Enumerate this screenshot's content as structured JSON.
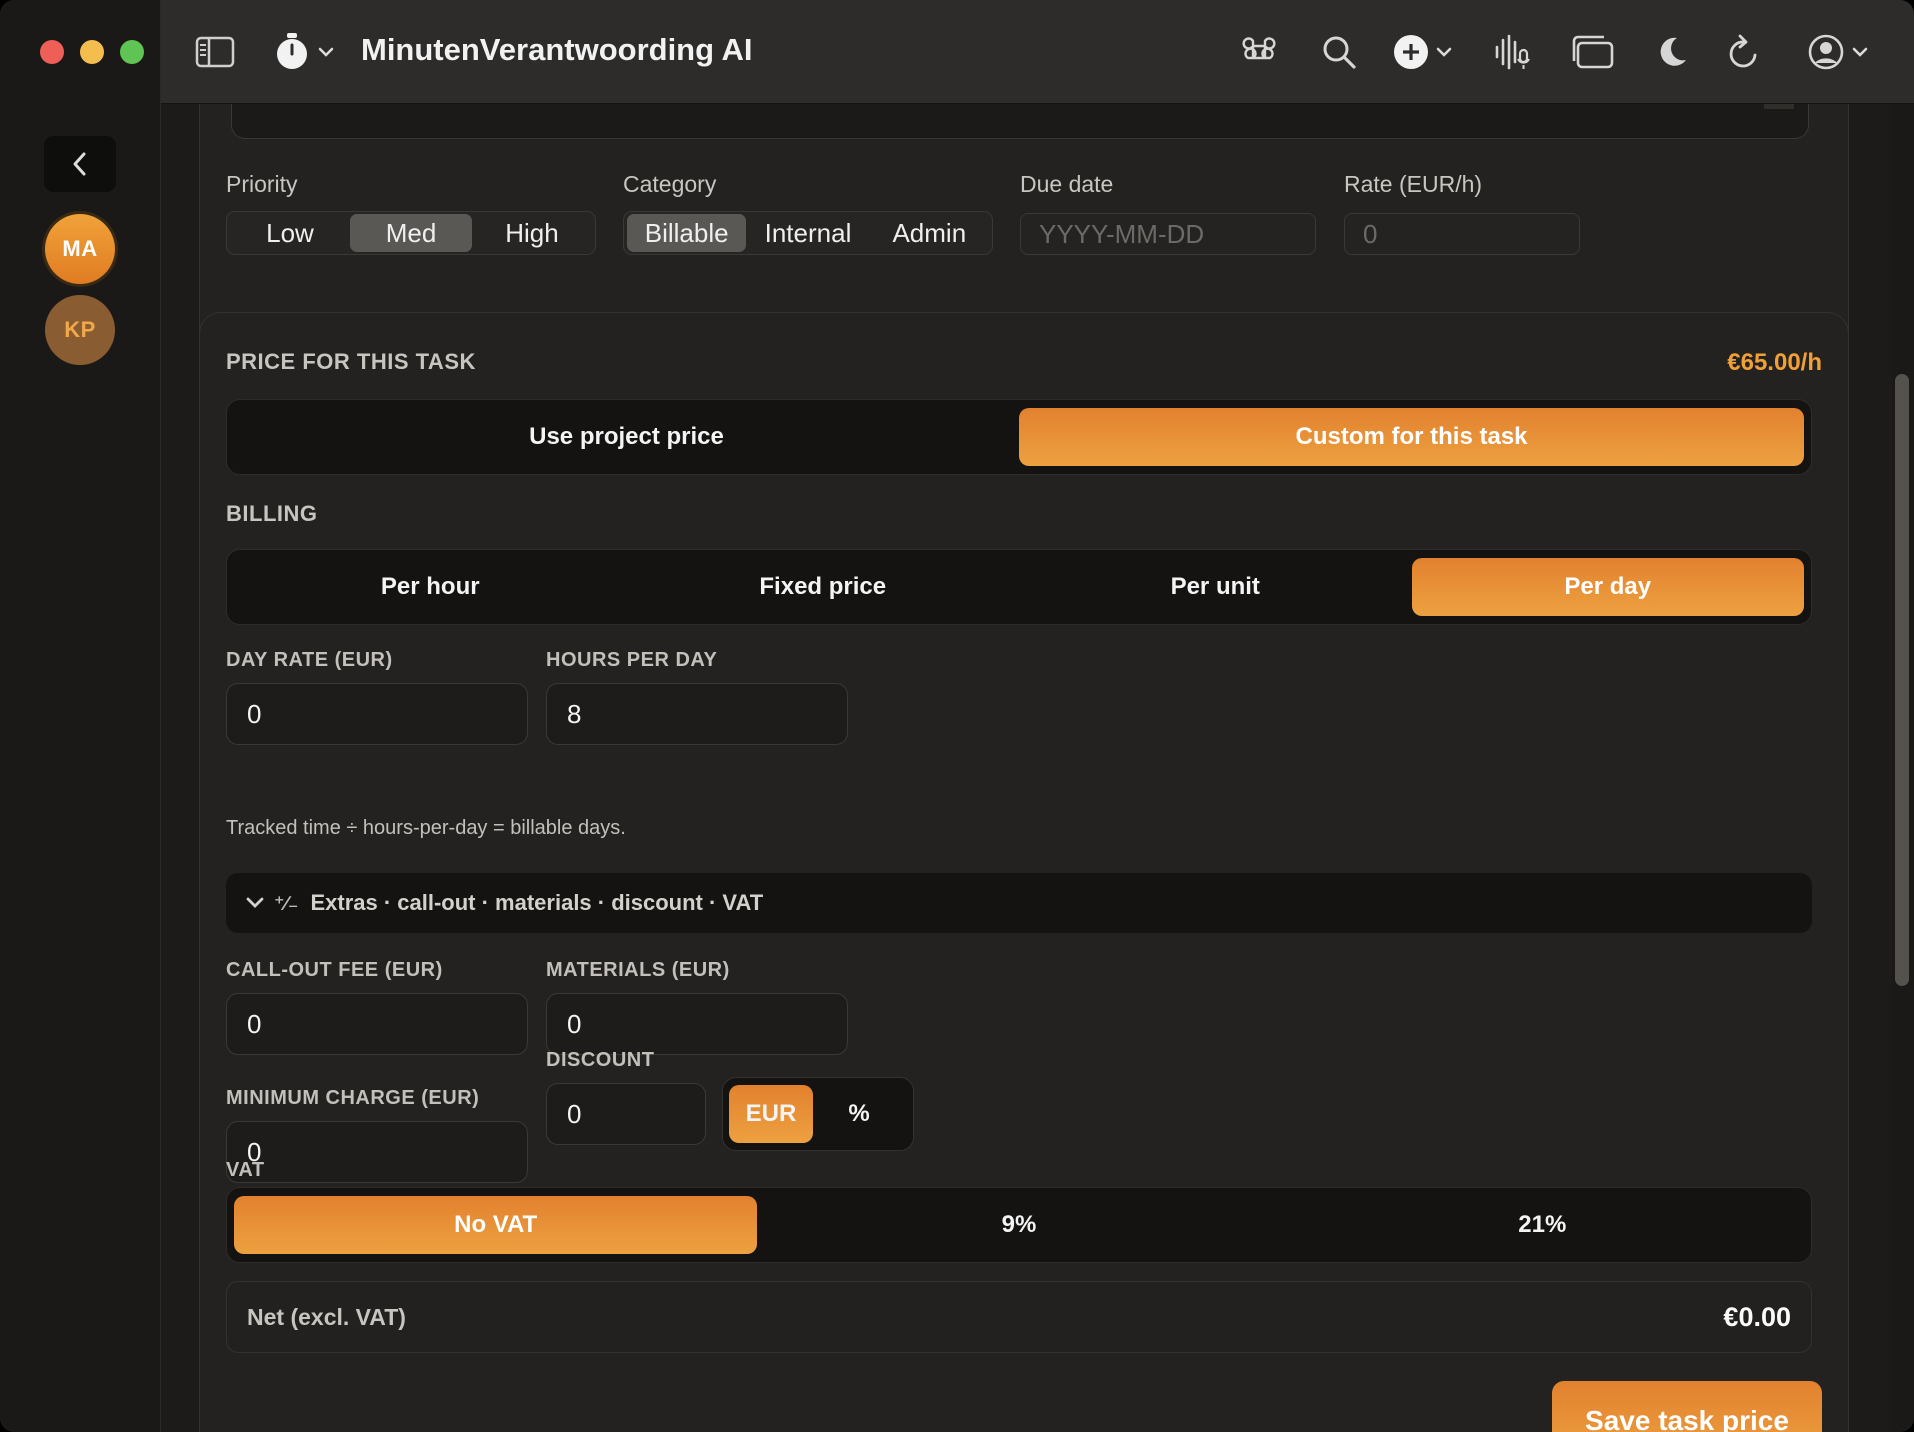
{
  "app": {
    "title": "MinutenVerantwoording AI"
  },
  "rail": {
    "avatars": [
      "MA",
      "KP"
    ]
  },
  "task": {
    "priority": {
      "label": "Priority",
      "options": [
        "Low",
        "Med",
        "High"
      ],
      "selected": "Med"
    },
    "category": {
      "label": "Category",
      "options": [
        "Billable",
        "Internal",
        "Admin"
      ],
      "selected": "Billable"
    },
    "due_date": {
      "label": "Due date",
      "placeholder": "YYYY-MM-DD"
    },
    "rate": {
      "label": "Rate (EUR/h)",
      "placeholder": "0"
    }
  },
  "price": {
    "heading": "PRICE FOR THIS TASK",
    "rate_display": "€65.00/h",
    "source_options": [
      "Use project price",
      "Custom for this task"
    ],
    "source_selected": "Custom for this task",
    "billing_heading": "BILLING",
    "billing_options": [
      "Per hour",
      "Fixed price",
      "Per unit",
      "Per day"
    ],
    "billing_selected": "Per day",
    "day_rate": {
      "label": "DAY RATE (EUR)",
      "value": "0"
    },
    "hours_per_day": {
      "label": "HOURS PER DAY",
      "value": "8"
    },
    "hint": "Tracked time ÷ hours-per-day = billable days.",
    "extras_label": "Extras · call-out · materials · discount · VAT",
    "call_out": {
      "label": "CALL-OUT FEE (EUR)",
      "value": "0"
    },
    "materials": {
      "label": "MATERIALS (EUR)",
      "value": "0"
    },
    "minimum": {
      "label": "MINIMUM CHARGE (EUR)",
      "value": "0"
    },
    "discount": {
      "label": "DISCOUNT",
      "value": "0",
      "unit_options": [
        "EUR",
        "%"
      ],
      "unit_selected": "EUR"
    },
    "vat_heading": "VAT",
    "vat_options": [
      "No VAT",
      "9%",
      "21%"
    ],
    "vat_selected": "No VAT",
    "net_label": "Net (excl. VAT)",
    "net_value": "€0.00",
    "save_label": "Save task price"
  },
  "colors": {
    "accent": "#E8903A",
    "background": "#1C1B19",
    "card": "#232220"
  },
  "icons": [
    "sidebar-toggle-icon",
    "stopwatch-icon",
    "command-icon",
    "search-icon",
    "add-circle-icon",
    "voice-icon",
    "window-icon",
    "moon-icon",
    "refresh-icon",
    "user-circle-icon",
    "chevron-left-icon",
    "chevron-down-icon",
    "percent-icon"
  ]
}
